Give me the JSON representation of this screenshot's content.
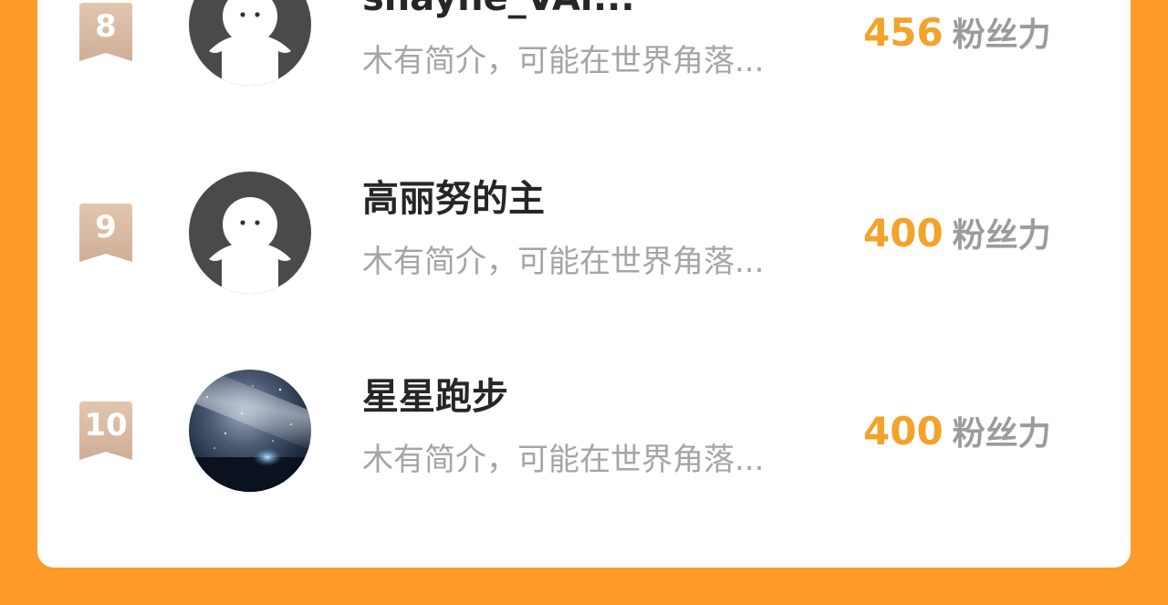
{
  "ranking": {
    "rows": [
      {
        "rank": "8",
        "name": "shayne_VAr...",
        "desc": "木有简介，可能在世界角落...",
        "fans_value": "456",
        "fans_label": "粉丝力",
        "avatar": "default-avatar-icon"
      },
      {
        "rank": "9",
        "name": "高丽努的主",
        "desc": "木有简介，可能在世界角落...",
        "fans_value": "400",
        "fans_label": "粉丝力",
        "avatar": "default-avatar-icon"
      },
      {
        "rank": "10",
        "name": "星星跑步",
        "desc": "木有简介，可能在世界角落...",
        "fans_value": "400",
        "fans_label": "粉丝力",
        "avatar": "starry-sky-avatar"
      }
    ]
  },
  "colors": {
    "background": "#FD9A28",
    "card": "#FFFFFF",
    "fans_value": "#F3A22B",
    "fans_label": "#9B9B9B",
    "name": "#262626",
    "desc": "#A5A5A5",
    "rank_badge": "#D9B8A0"
  }
}
